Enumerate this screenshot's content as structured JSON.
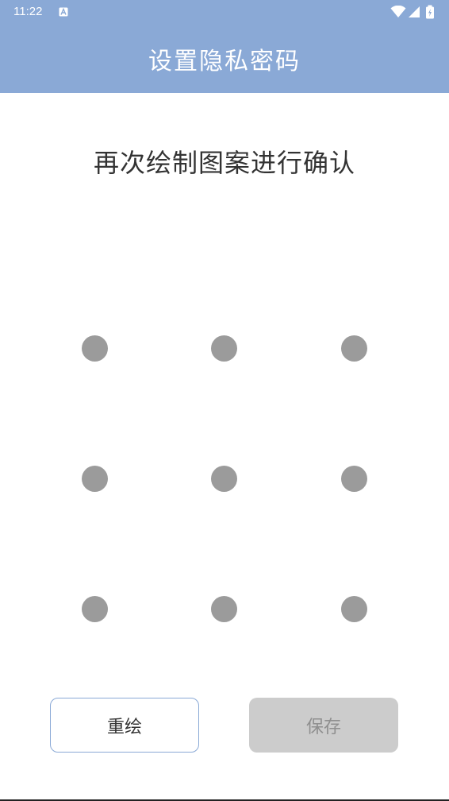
{
  "status_bar": {
    "time": "11:22",
    "app_icon": "a-badge-icon",
    "icons": [
      "wifi-icon",
      "cellular-signal-icon",
      "battery-charging-icon"
    ]
  },
  "header": {
    "title": "设置隐私密码",
    "background": "#8aa9d6"
  },
  "instruction": "再次绘制图案进行确认",
  "pattern": {
    "rows": 3,
    "cols": 3,
    "dot_color": "#9b9b9b"
  },
  "buttons": {
    "redraw": "重绘",
    "save": "保存"
  }
}
